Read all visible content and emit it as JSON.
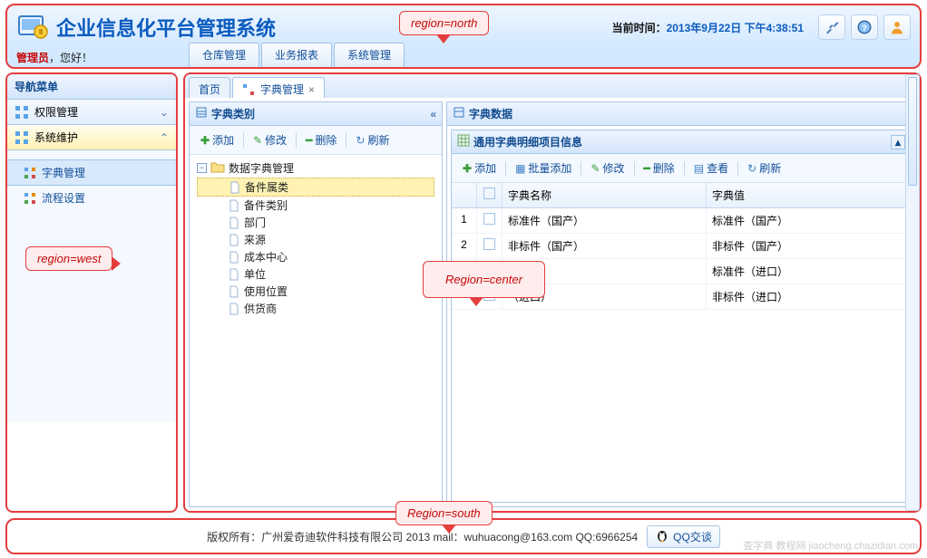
{
  "header": {
    "title": "企业信息化平台管理系统",
    "time_label": "当前时间：",
    "time_value": "2013年9月22日 下午4:38:51",
    "greet_user": "管理员",
    "greet_text": "，您好！",
    "top_tabs": [
      "仓库管理",
      "业务报表",
      "系统管理"
    ]
  },
  "nav": {
    "title": "导航菜单",
    "groups": [
      {
        "label": "权限管理",
        "expanded": false
      },
      {
        "label": "系统维护",
        "expanded": true
      }
    ],
    "items": [
      {
        "label": "字典管理",
        "active": true
      },
      {
        "label": "流程设置",
        "active": false
      }
    ]
  },
  "tabs": [
    {
      "label": "首页",
      "closable": false,
      "active": false
    },
    {
      "label": "字典管理",
      "closable": true,
      "active": true
    }
  ],
  "left_panel": {
    "title": "字典类别",
    "toolbar": [
      "添加",
      "修改",
      "删除",
      "刷新"
    ],
    "root": "数据字典管理",
    "children": [
      "备件属类",
      "备件类别",
      "部门",
      "来源",
      "成本中心",
      "单位",
      "使用位置",
      "供货商"
    ],
    "selected": 0
  },
  "right_panel": {
    "title": "字典数据",
    "inner_title": "通用字典明细项目信息",
    "toolbar": [
      "添加",
      "批量添加",
      "修改",
      "删除",
      "查看",
      "刷新"
    ],
    "columns": [
      "字典名称",
      "字典值"
    ],
    "rows": [
      {
        "name": "标准件（国产）",
        "value": "标准件（国产）"
      },
      {
        "name": "非标件（国产）",
        "value": "非标件（国产）"
      },
      {
        "name": "（进口）",
        "value": "标准件（进口）"
      },
      {
        "name": "（进口）",
        "value": "非标件（进口）"
      }
    ]
  },
  "callouts": {
    "north": "region=north",
    "west": "region=west",
    "center": "Region=center",
    "south": "Region=south"
  },
  "footer": {
    "text": "版权所有：广州爱奇迪软件科技有限公司 2013   mail：wuhuacong@163.com QQ:6966254",
    "qq": "QQ交谈"
  },
  "watermark": "查字典  教程网  jiaocheng.chazidian.com"
}
